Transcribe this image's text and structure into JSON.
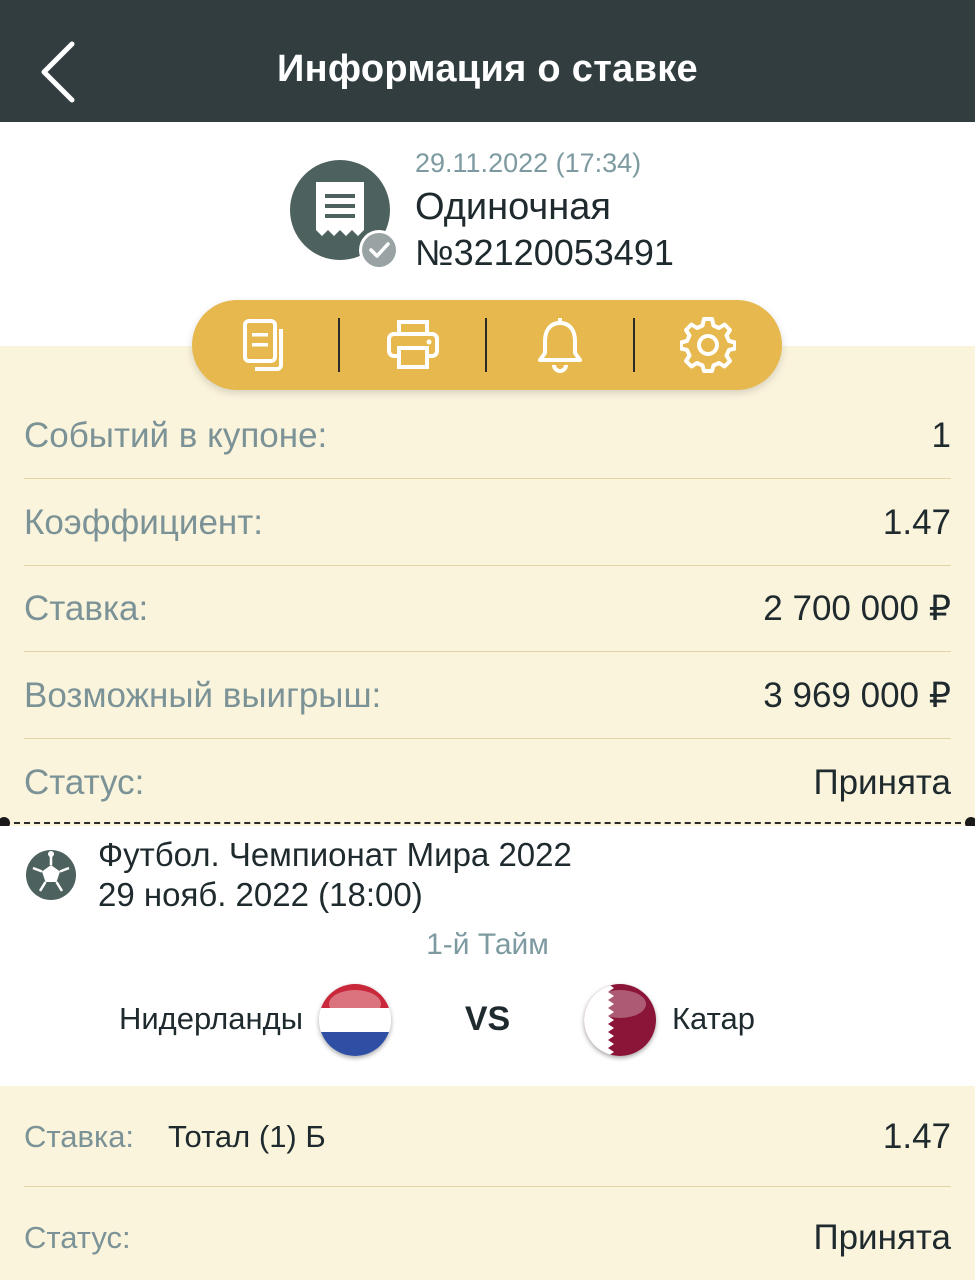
{
  "header": {
    "title": "Информация о ставке"
  },
  "bet": {
    "date": "29.11.2022 (17:34)",
    "type": "Одиночная",
    "number": "№32120053491"
  },
  "actions": [
    {
      "icon": "copy-document-icon"
    },
    {
      "icon": "printer-icon"
    },
    {
      "icon": "bell-icon"
    },
    {
      "icon": "gear-icon"
    }
  ],
  "summary": [
    {
      "label": "Событий в купоне:",
      "value": "1"
    },
    {
      "label": "Коэффициент:",
      "value": "1.47"
    },
    {
      "label": "Ставка:",
      "value": "2 700 000 ₽"
    },
    {
      "label": "Возможный выигрыш:",
      "value": "3 969 000 ₽"
    },
    {
      "label": "Статус:",
      "value": "Принята"
    }
  ],
  "event": {
    "league": "Футбол. Чемпионат Мира 2022",
    "date": "29 нояб. 2022 (18:00)",
    "period": "1-й Тайм",
    "team1": "Нидерланды",
    "vs": "VS",
    "team2": "Катар"
  },
  "selection": {
    "bet_label": "Ставка:",
    "market": "Тотал (1) Б",
    "odds": "1.47",
    "status_label": "Статус:",
    "status": "Принята"
  },
  "colors": {
    "topbar": "#323d40",
    "accent": "#e6b84e",
    "panel": "#fbf4dc",
    "muted": "#7b9296"
  }
}
